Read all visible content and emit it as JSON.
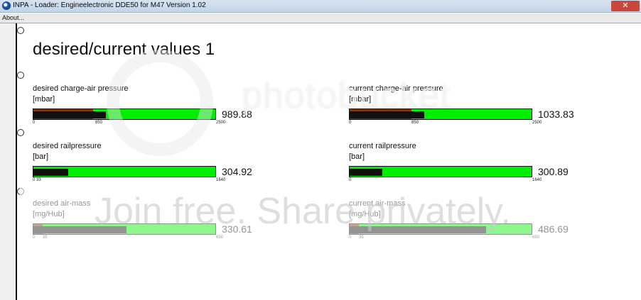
{
  "window": {
    "title": "INPA - Loader:  Engineelectronic DDE50 for M47 Version 1.02"
  },
  "menu": {
    "about": "About..."
  },
  "page": {
    "title": "desired/current values 1"
  },
  "gauges": [
    {
      "name": "desired charge-air pressure",
      "unit": "[mbar]",
      "value": "989.88",
      "ticks": [
        "0",
        "850",
        "2500"
      ],
      "level": 0.4,
      "red_level": 0.33
    },
    {
      "name": "current charge-air pressure",
      "unit": "[mbar]",
      "value": "1033.83",
      "ticks": [
        "0",
        "850",
        "2500"
      ],
      "level": 0.41,
      "red_level": 0.34
    },
    {
      "name": "desired railpressure",
      "unit": "[bar]",
      "value": "304.92",
      "ticks": [
        "0 33",
        "1640"
      ],
      "level": 0.19,
      "red_level": 0.0
    },
    {
      "name": "current railpressure",
      "unit": "[bar]",
      "value": "300.89",
      "ticks": [
        "0",
        "1640"
      ],
      "level": 0.18,
      "red_level": 0.0
    },
    {
      "name": "desired air-mass",
      "unit": "[mg/Hub]",
      "value": "330.61",
      "ticks": [
        "0",
        "35",
        "650"
      ],
      "level": 0.51,
      "red_level": 0.05
    },
    {
      "name": "current air-mass",
      "unit": "[mg/Hub]",
      "value": "486.69",
      "ticks": [
        "0",
        "35",
        "650"
      ],
      "level": 0.75,
      "red_level": 0.05
    }
  ],
  "watermark": {
    "brand": "photobucket",
    "slogan": "Join free. Share privately."
  },
  "colors": {
    "bar_green": "#00ee00",
    "bar_fill": "#111111",
    "bar_red": "#8b1818"
  }
}
